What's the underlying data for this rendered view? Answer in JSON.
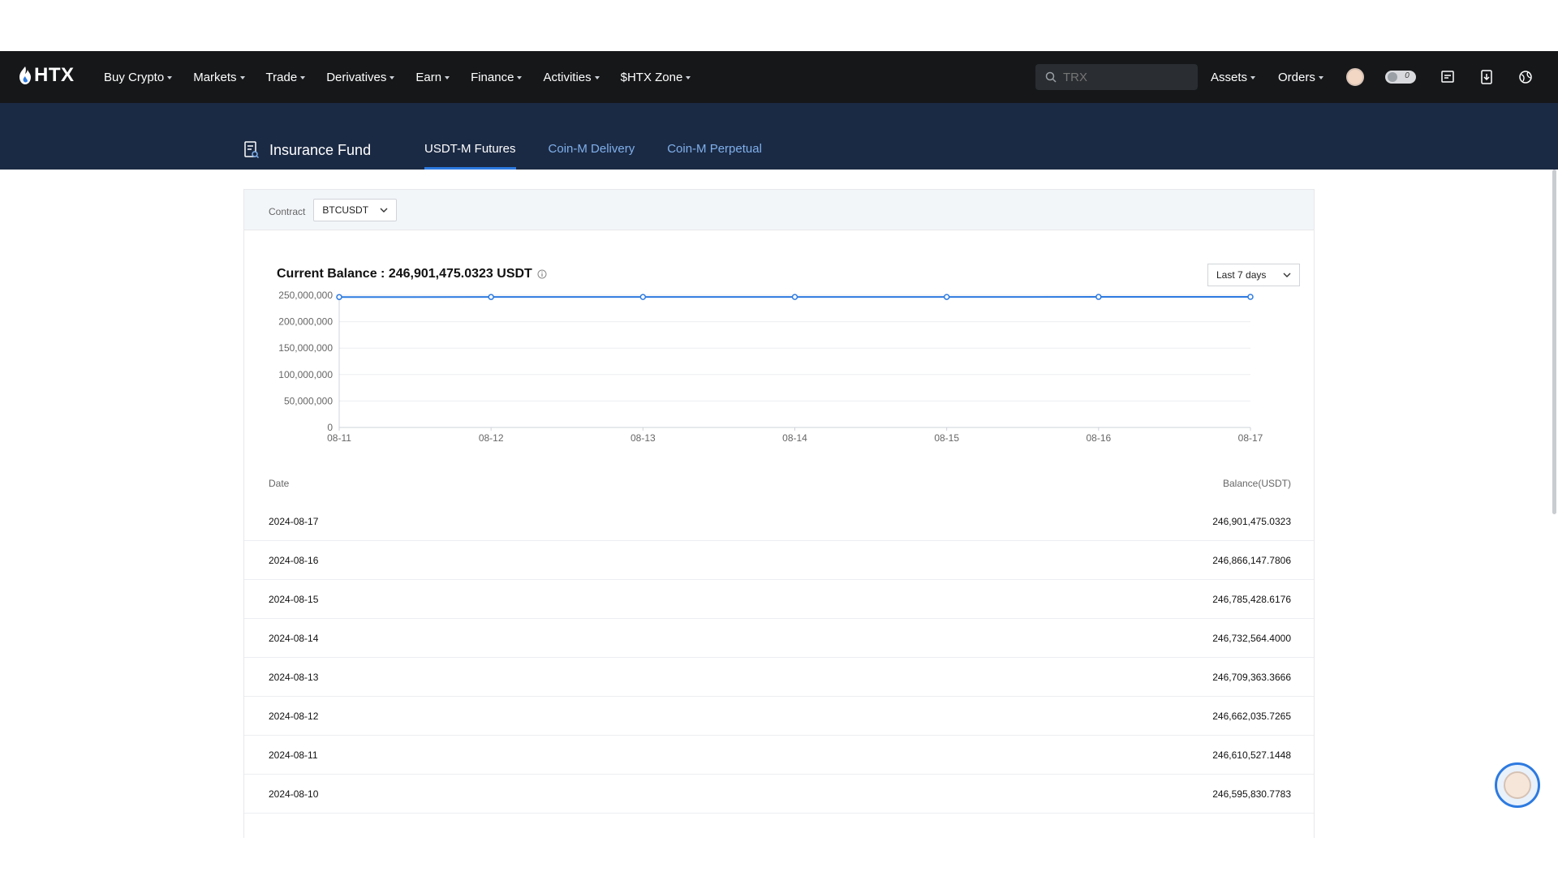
{
  "nav": {
    "logo_text": "HTX",
    "menu": [
      {
        "label": "Buy Crypto",
        "name": "nav-buy-crypto"
      },
      {
        "label": "Markets",
        "name": "nav-markets"
      },
      {
        "label": "Trade",
        "name": "nav-trade"
      },
      {
        "label": "Derivatives",
        "name": "nav-derivatives"
      },
      {
        "label": "Earn",
        "name": "nav-earn"
      },
      {
        "label": "Finance",
        "name": "nav-finance"
      },
      {
        "label": "Activities",
        "name": "nav-activities"
      },
      {
        "label": "$HTX Zone",
        "name": "nav-htx-zone"
      }
    ],
    "search_placeholder": "TRX",
    "assets_label": "Assets",
    "orders_label": "Orders",
    "notification_count": "0"
  },
  "banner": {
    "title": "Insurance Fund",
    "tabs": [
      {
        "label": "USDT-M Futures",
        "active": true
      },
      {
        "label": "Coin-M Delivery",
        "active": false
      },
      {
        "label": "Coin-M Perpetual",
        "active": false
      }
    ]
  },
  "filter": {
    "contract_label": "Contract",
    "contract_value": "BTCUSDT"
  },
  "balance": {
    "text": "Current Balance : 246,901,475.0323 USDT",
    "range_value": "Last 7 days"
  },
  "chart_data": {
    "type": "line",
    "x": [
      "08-11",
      "08-12",
      "08-13",
      "08-14",
      "08-15",
      "08-16",
      "08-17"
    ],
    "series": [
      {
        "values": [
          246610527.1448,
          246662035.7265,
          246709363.3666,
          246732564.4,
          246785428.6176,
          246866147.7806,
          246901475.0323
        ]
      }
    ],
    "ylim": [
      0,
      250000000
    ],
    "yticks": [
      "250,000,000",
      "200,000,000",
      "150,000,000",
      "100,000,000",
      "50,000,000",
      "0"
    ],
    "ytick_values": [
      250000000,
      200000000,
      150000000,
      100000000,
      50000000,
      0
    ],
    "grid": true,
    "color": "#2d7ae0"
  },
  "table": {
    "headers": {
      "date": "Date",
      "balance": "Balance(USDT)"
    },
    "rows": [
      {
        "date": "2024-08-17",
        "balance": "246,901,475.0323"
      },
      {
        "date": "2024-08-16",
        "balance": "246,866,147.7806"
      },
      {
        "date": "2024-08-15",
        "balance": "246,785,428.6176"
      },
      {
        "date": "2024-08-14",
        "balance": "246,732,564.4000"
      },
      {
        "date": "2024-08-13",
        "balance": "246,709,363.3666"
      },
      {
        "date": "2024-08-12",
        "balance": "246,662,035.7265"
      },
      {
        "date": "2024-08-11",
        "balance": "246,610,527.1448"
      },
      {
        "date": "2024-08-10",
        "balance": "246,595,830.7783"
      }
    ]
  },
  "colors": {
    "nav_bg": "#151719",
    "banner_bg": "#1b2a44",
    "accent": "#2d7ae0",
    "tab_inactive": "#7fb0ec"
  }
}
